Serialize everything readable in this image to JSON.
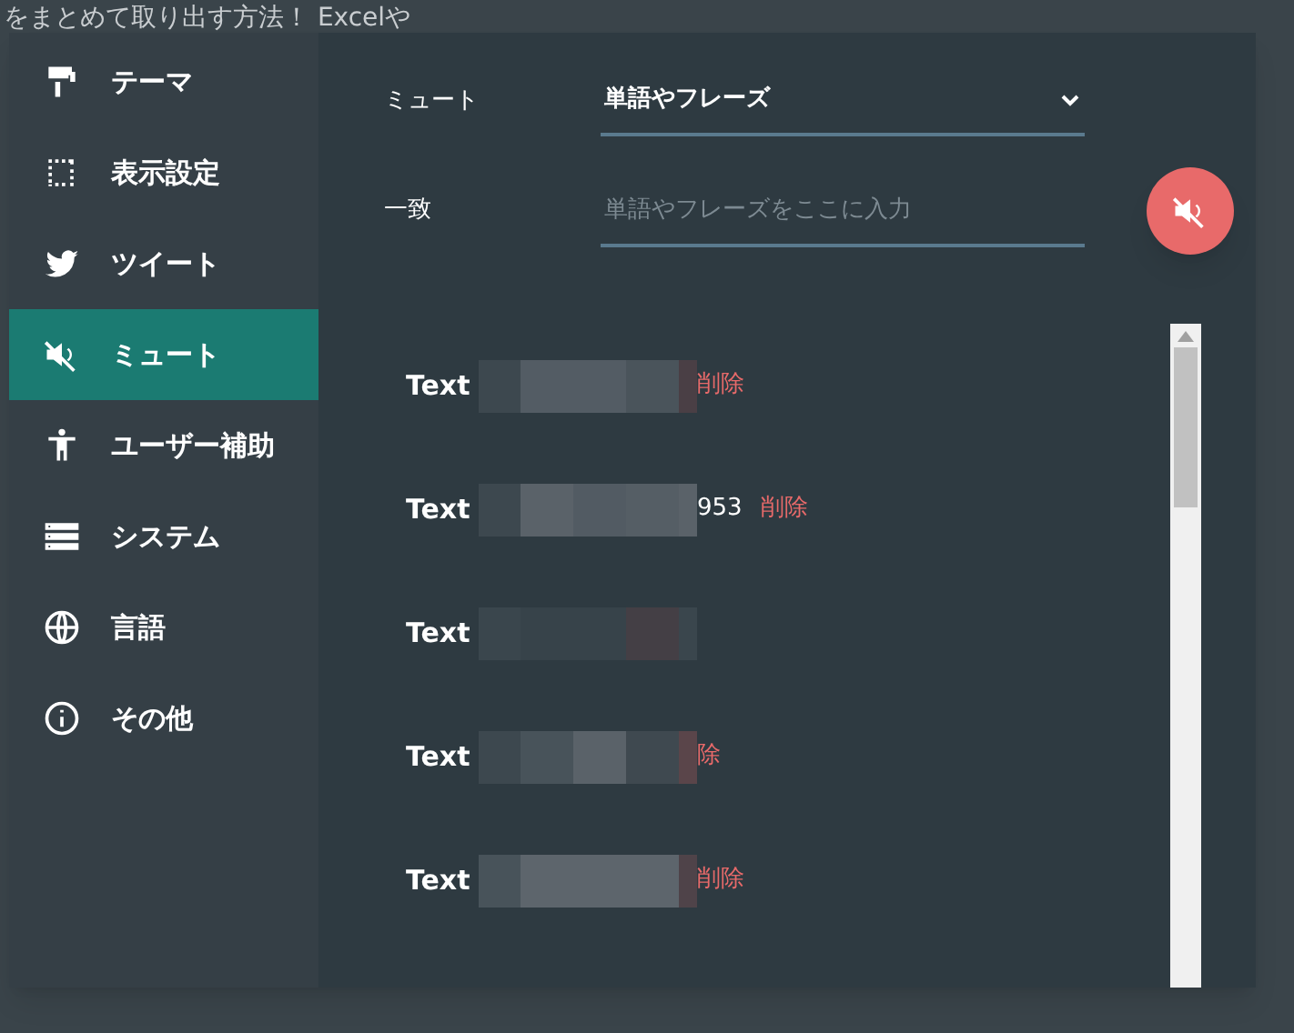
{
  "background": {
    "headline": "をまとめて取り出す方法！ Excelや"
  },
  "sidebar": {
    "items": [
      {
        "label": "テーマ",
        "kind": "roller",
        "selected": false
      },
      {
        "label": "表示設定",
        "kind": "frame",
        "selected": false
      },
      {
        "label": "ツイート",
        "kind": "bird",
        "selected": false
      },
      {
        "label": "ミュート",
        "kind": "mute",
        "selected": true
      },
      {
        "label": "ユーザー補助",
        "kind": "person",
        "selected": false
      },
      {
        "label": "システム",
        "kind": "server",
        "selected": false
      },
      {
        "label": "言語",
        "kind": "globe",
        "selected": false
      },
      {
        "label": "その他",
        "kind": "info",
        "selected": false
      }
    ]
  },
  "form": {
    "mute_label": "ミュート",
    "mute_type": "単語やフレーズ",
    "match_label": "一致",
    "match_placeholder": "単語やフレーズをここに入力"
  },
  "muted_list": [
    {
      "label": "Text",
      "delete": "削除"
    },
    {
      "label": "Text",
      "suffix": "953",
      "delete": "削除"
    },
    {
      "label": "Text"
    },
    {
      "label": "Text",
      "delete": "除"
    },
    {
      "label": "Text",
      "delete": "削除"
    }
  ]
}
